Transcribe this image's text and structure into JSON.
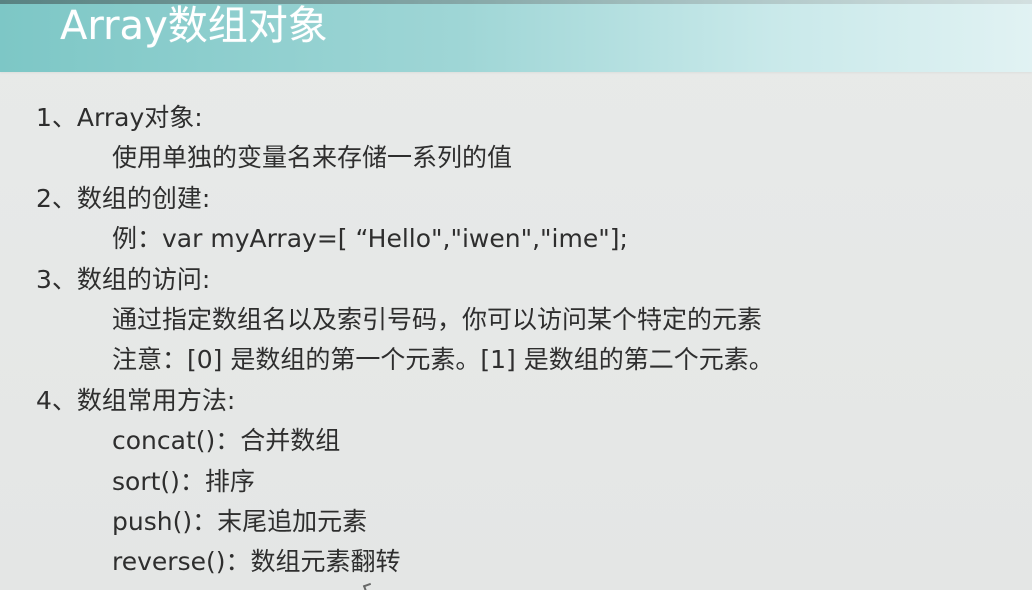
{
  "slide": {
    "title": "Array数组对象",
    "lines": [
      {
        "level": 1,
        "text": "1、Array对象:"
      },
      {
        "level": 2,
        "text": "使用单独的变量名来存储一系列的值"
      },
      {
        "level": 1,
        "text": "2、数组的创建:"
      },
      {
        "level": 2,
        "text": "例：var myArray=[ “Hello\",\"iwen\",\"ime\"];"
      },
      {
        "level": 1,
        "text": "3、数组的访问:"
      },
      {
        "level": 2,
        "text": "通过指定数组名以及索引号码，你可以访问某个特定的元素"
      },
      {
        "level": 2,
        "text": "注意：[0] 是数组的第一个元素。[1] 是数组的第二个元素。"
      },
      {
        "level": 1,
        "text": "4、数组常用方法:"
      },
      {
        "level": 2,
        "text": "concat()：合并数组"
      },
      {
        "level": 2,
        "text": "sort()：排序"
      },
      {
        "level": 2,
        "text": "push()：末尾追加元素"
      },
      {
        "level": 2,
        "text": "reverse()：数组元素翻转"
      }
    ]
  }
}
